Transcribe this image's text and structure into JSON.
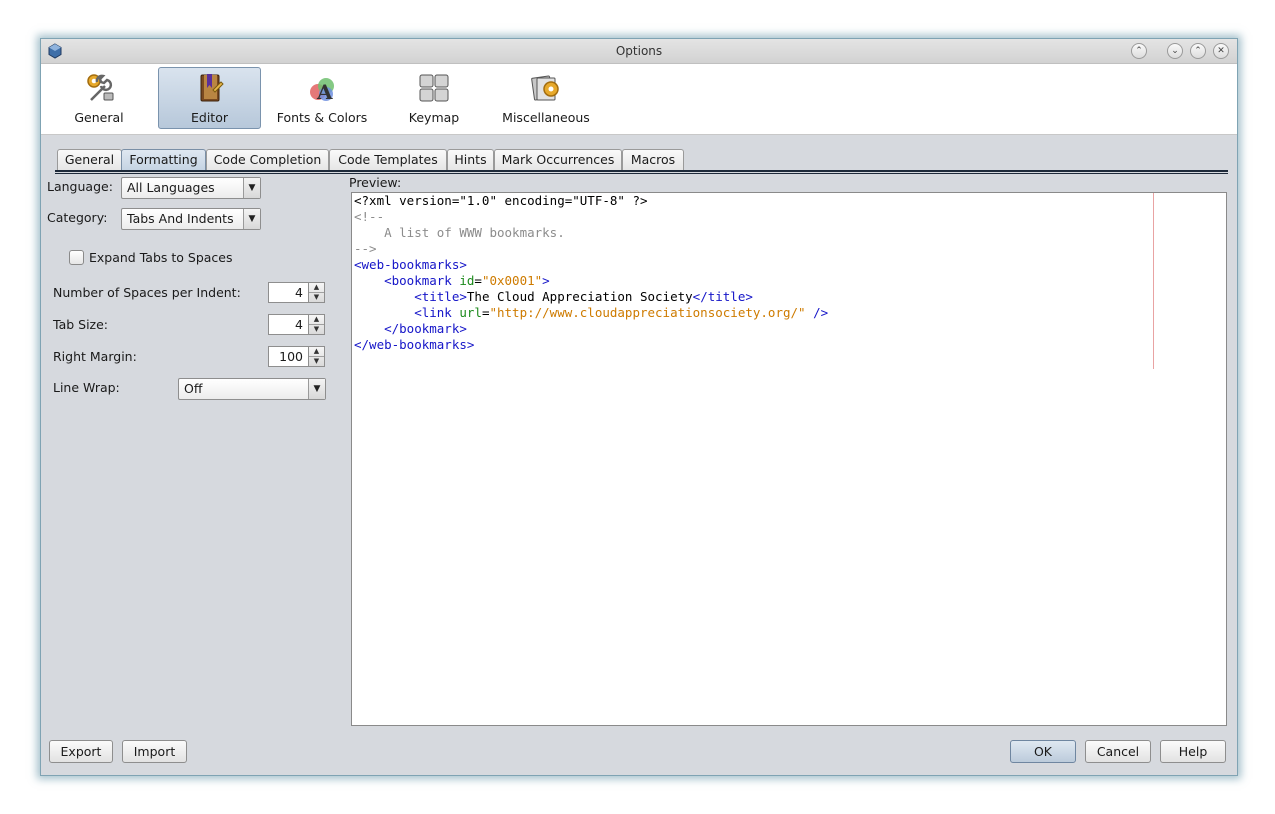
{
  "window": {
    "title": "Options"
  },
  "categories": [
    {
      "label": "General",
      "icon": "wrench-gear-icon",
      "selected": false
    },
    {
      "label": "Editor",
      "icon": "book-icon",
      "selected": true
    },
    {
      "label": "Fonts & Colors",
      "icon": "fonts-colors-icon",
      "selected": false
    },
    {
      "label": "Keymap",
      "icon": "keyboard-icon",
      "selected": false
    },
    {
      "label": "Miscellaneous",
      "icon": "misc-gear-icon",
      "selected": false
    }
  ],
  "tabs": [
    {
      "label": "General",
      "selected": false
    },
    {
      "label": "Formatting",
      "selected": true
    },
    {
      "label": "Code Completion",
      "selected": false
    },
    {
      "label": "Code Templates",
      "selected": false
    },
    {
      "label": "Hints",
      "selected": false
    },
    {
      "label": "Mark Occurrences",
      "selected": false
    },
    {
      "label": "Macros",
      "selected": false
    }
  ],
  "settings": {
    "language_label": "Language:",
    "language_value": "All Languages",
    "category_label": "Category:",
    "category_value": "Tabs And Indents",
    "expand_tabs_label": "Expand Tabs to Spaces",
    "expand_tabs_checked": false,
    "spaces_per_indent_label": "Number of Spaces per Indent:",
    "spaces_per_indent_value": "4",
    "tab_size_label": "Tab Size:",
    "tab_size_value": "4",
    "right_margin_label": "Right Margin:",
    "right_margin_value": "100",
    "line_wrap_label": "Line Wrap:",
    "line_wrap_value": "Off"
  },
  "preview": {
    "label": "Preview:",
    "lines": [
      [
        {
          "t": "<?xml version=\"1.0\" encoding=\"UTF-8\" ?>",
          "c": "pi"
        }
      ],
      [
        {
          "t": "<!--",
          "c": "cm"
        }
      ],
      [
        {
          "t": "    A list of WWW bookmarks.",
          "c": "cm"
        }
      ],
      [
        {
          "t": "-->",
          "c": "cm"
        }
      ],
      [
        {
          "t": "<web-bookmarks>",
          "c": "tag"
        }
      ],
      [
        {
          "t": "    <bookmark ",
          "c": "tag"
        },
        {
          "t": "id",
          "c": "attr"
        },
        {
          "t": "=",
          "c": "txt"
        },
        {
          "t": "\"0x0001\"",
          "c": "val"
        },
        {
          "t": ">",
          "c": "tag"
        }
      ],
      [
        {
          "t": "        <title>",
          "c": "tag"
        },
        {
          "t": "The Cloud Appreciation Society",
          "c": "txt"
        },
        {
          "t": "</title>",
          "c": "tag"
        }
      ],
      [
        {
          "t": "        <link ",
          "c": "tag"
        },
        {
          "t": "url",
          "c": "attr"
        },
        {
          "t": "=",
          "c": "txt"
        },
        {
          "t": "\"http://www.cloudappreciationsociety.org/\"",
          "c": "val"
        },
        {
          "t": " />",
          "c": "tag"
        }
      ],
      [
        {
          "t": "    </bookmark>",
          "c": "tag"
        }
      ],
      [
        {
          "t": "</web-bookmarks>",
          "c": "tag"
        }
      ]
    ]
  },
  "buttons": {
    "export": "Export",
    "import": "Import",
    "ok": "OK",
    "cancel": "Cancel",
    "help": "Help"
  }
}
